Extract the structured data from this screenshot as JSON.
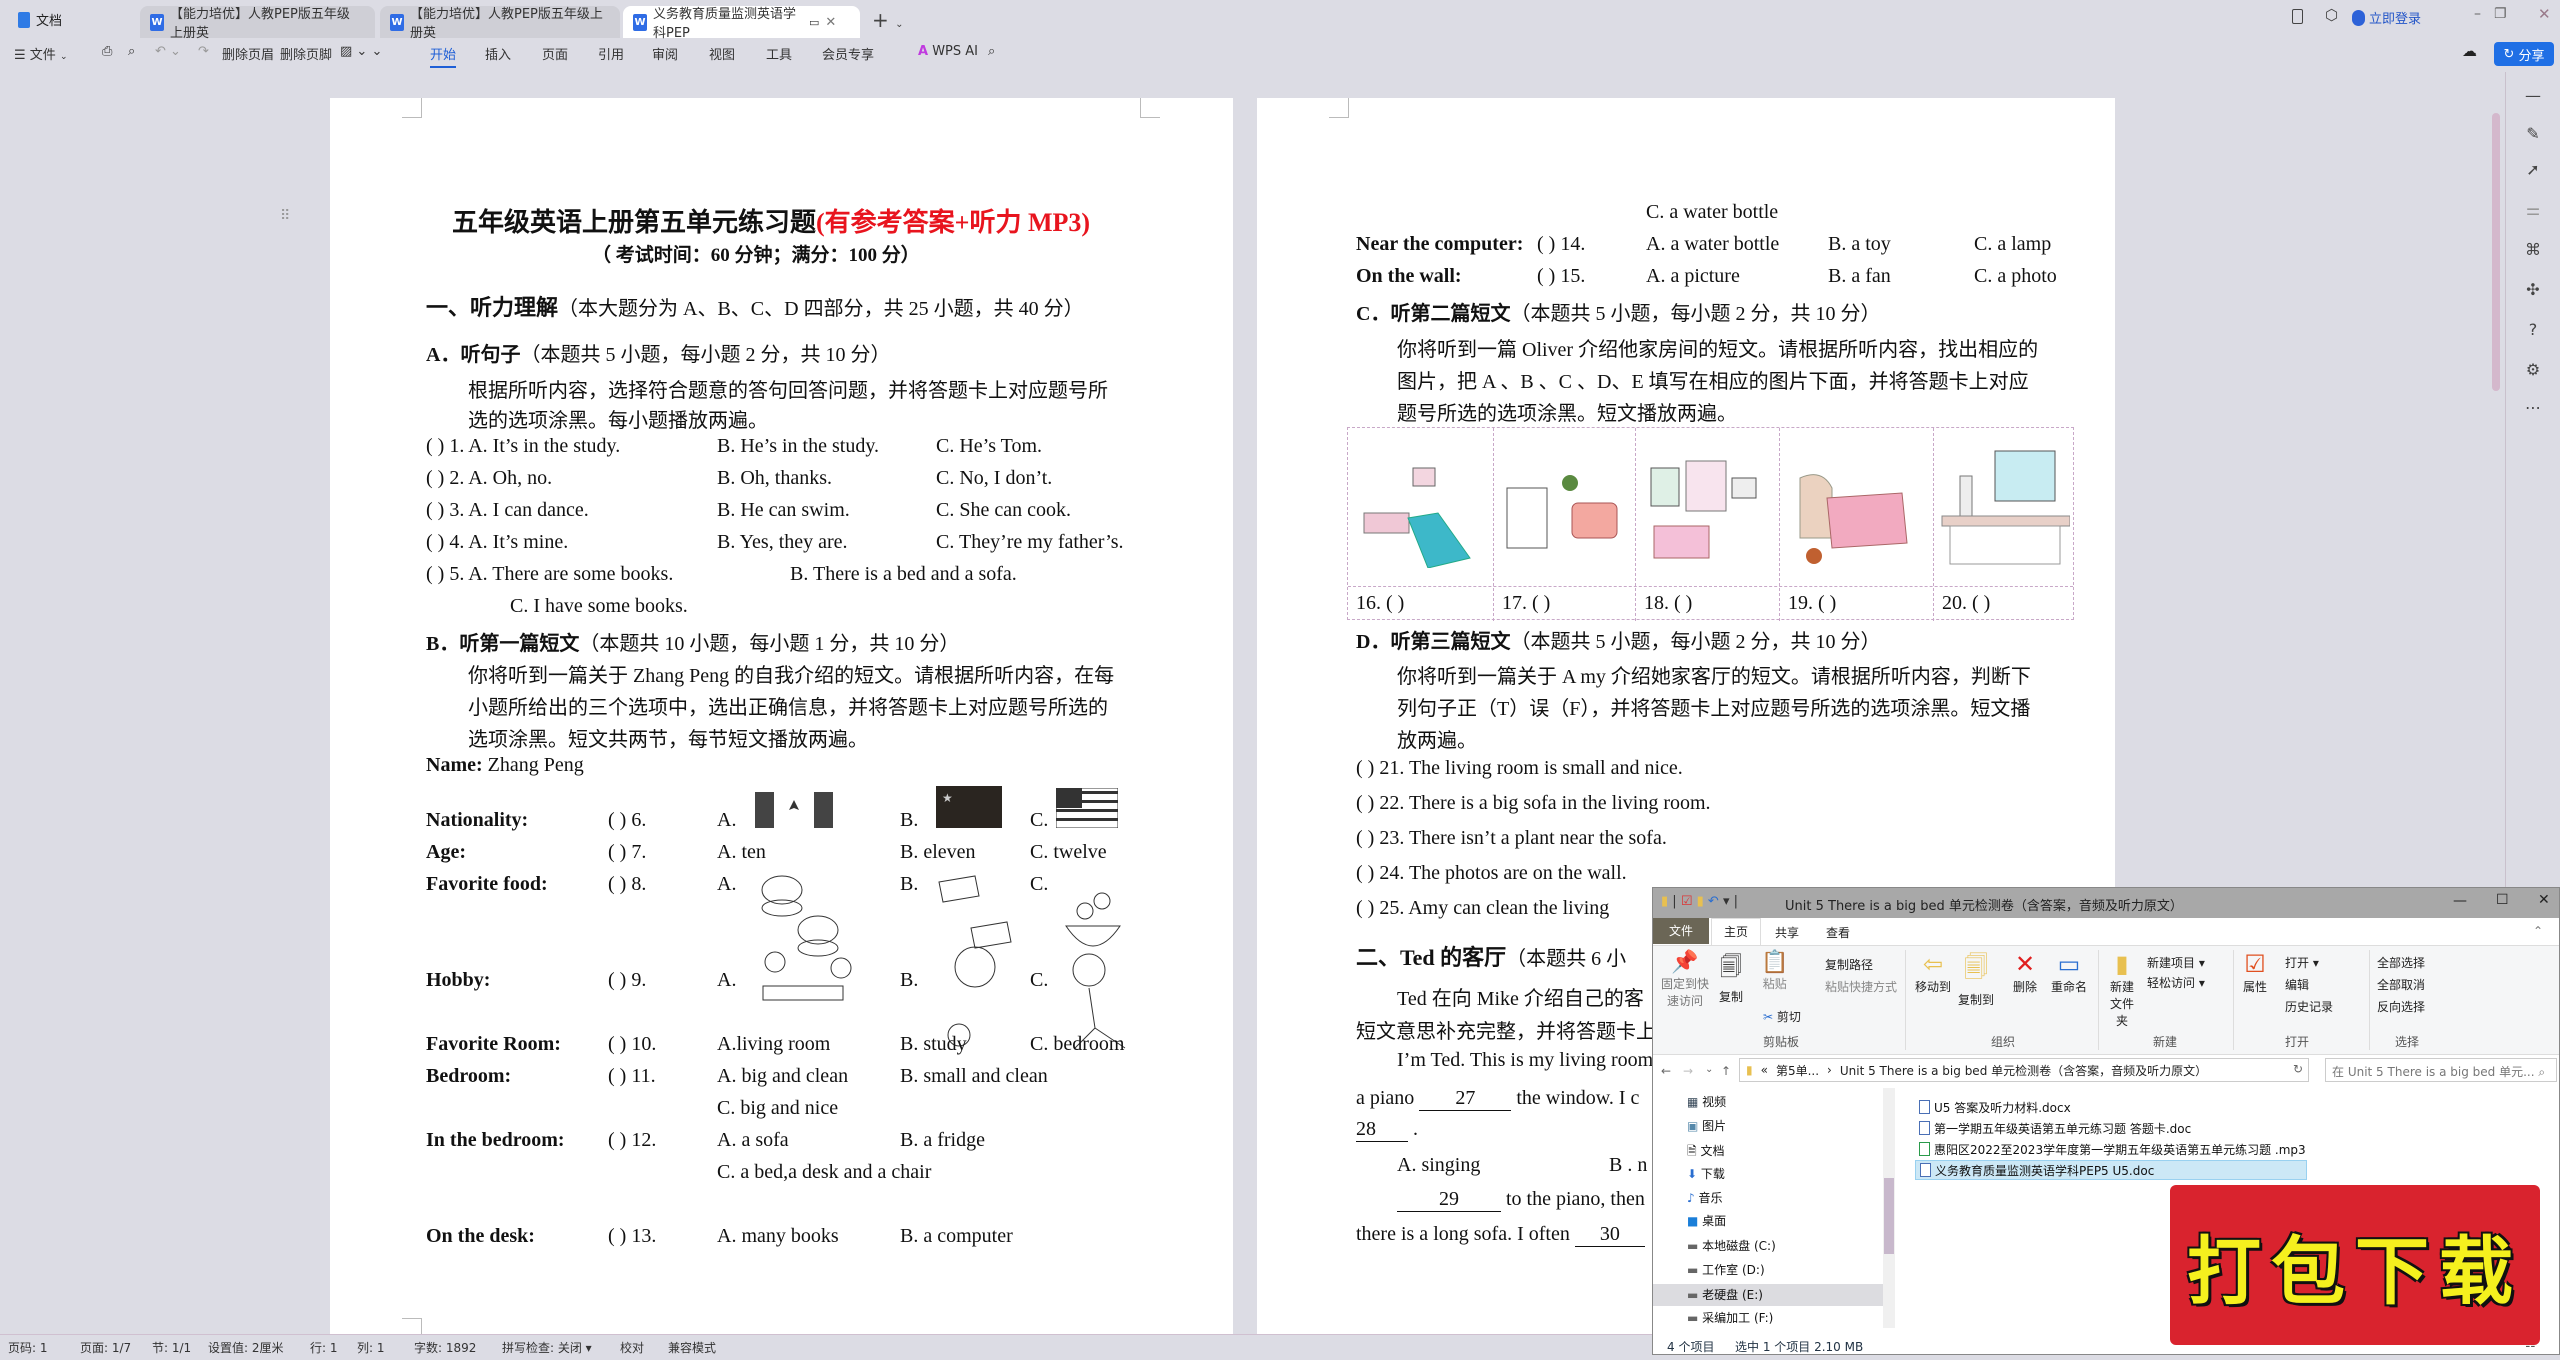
{
  "titlebar": {
    "home_tab": "文档",
    "tabs": [
      "【能力培优】人教PEP版五年级上册英",
      "【能力培优】人教PEP版五年级上册英",
      "义务教育质量监测英语学科PEP"
    ],
    "login": "立即登录"
  },
  "toolbar": {
    "file_menu": "文件",
    "delete_header": "删除页眉",
    "delete_footer": "删除页脚",
    "tabs": [
      "开始",
      "插入",
      "页面",
      "引用",
      "审阅",
      "视图",
      "工具",
      "会员专享"
    ],
    "active_tab": "开始",
    "wps_ai": "WPS AI",
    "share": "分享",
    "accent": "#1f6fe5"
  },
  "left_page": {
    "title": "五年级英语上册第五单元练习题",
    "title_highlight": "(有参考答案+听力 MP3)",
    "subtitle": "（ 考试时间：60 分钟；满分：100 分）",
    "sec1_heading": "一、听力理解",
    "sec1_note": "（本大题分为 A、B、C、D 四部分，共 25 小题，共 40 分）",
    "partA_heading": "A．听句子",
    "partA_note": "（本题共 5 小题，每小题 2 分，共 10 分）",
    "partA_instr": [
      "根据所听内容，选择符合题意的答句回答问题，并将答题卡上对应题号所",
      "选的选项涂黑。每小题播放两遍。"
    ],
    "partA_items": [
      {
        "q": "(      ) 1. A. It’s in the study.",
        "b": "B. He’s in the study.",
        "c": "C. He’s Tom."
      },
      {
        "q": "(      ) 2. A. Oh, no.",
        "b": "B. Oh, thanks.",
        "c": "C. No, I don’t."
      },
      {
        "q": "(      ) 3. A. I can dance.",
        "b": "B. He can swim.",
        "c": "C. She can cook."
      },
      {
        "q": "(      ) 4. A. It’s mine.",
        "b": "B. Yes, they are.",
        "c": "C. They’re my father’s."
      },
      {
        "q": "(      ) 5. A. There are some books.",
        "b": "B. There is a bed and a sofa.",
        "c": "C. I have some books."
      }
    ],
    "partB_heading": "B．听第一篇短文",
    "partB_note": "（本题共 10 小题，每小题 1 分，共 10 分）",
    "partB_instr": [
      "你将听到一篇关于 Zhang Peng 的自我介绍的短文。请根据所听内容，在每",
      "小题所给出的三个选项中，选出正确信息，并将答题卡上对应题号所选的",
      "选项涂黑。短文共两节，每节短文播放两遍。"
    ],
    "name_label": "Name:",
    "name_value": " Zhang Peng",
    "rows": [
      {
        "label": "Nationality:",
        "num": "(      ) 6.",
        "a": "A.",
        "b": "B.",
        "c": "C."
      },
      {
        "label": "Age:",
        "num": "(      ) 7.",
        "a": "A. ten",
        "b": "B. eleven",
        "c": "C. twelve"
      },
      {
        "label": "Favorite food:",
        "num": "(      ) 8.",
        "a": "A.",
        "b": "B.",
        "c": "C."
      },
      {
        "label": "Hobby:",
        "num": "(      ) 9.",
        "a": "A.",
        "b": "B.",
        "c": "C."
      },
      {
        "label": "Favorite Room:",
        "num": "(      ) 10.",
        "a": "A.living room",
        "b": "B. study",
        "c": "C. bedroom"
      },
      {
        "label": "Bedroom:",
        "num": "(      ) 11.",
        "a": "A. big and clean",
        "b": "B. small and clean",
        "c": "C. big and nice"
      },
      {
        "label": "In the bedroom:",
        "num": "(      ) 12.",
        "a": "A. a sofa",
        "b": "B. a fridge",
        "c": "C. a bed,a desk and a chair"
      },
      {
        "label": "On the desk:",
        "num": "(      ) 13.",
        "a": "A. many books",
        "b": "B. a computer"
      }
    ]
  },
  "right_page": {
    "q13_c": "C. a water bottle",
    "rows": [
      {
        "label": "Near the computer:",
        "num": "(      ) 14.",
        "a": "A. a water bottle",
        "b": "B. a toy",
        "c": "C. a lamp"
      },
      {
        "label": "On the wall:",
        "num": "(      ) 15.",
        "a": "A. a picture",
        "b": "B. a fan",
        "c": "C. a photo"
      }
    ],
    "partC_heading": "C．听第二篇短文",
    "partC_note": "（本题共 5 小题，每小题 2 分，共 10 分）",
    "partC_instr": [
      "你将听到一篇 Oliver  介绍他家房间的短文。请根据所听内容，找出相应的",
      "图片，把 A 、B 、C 、D、E 填写在相应的图片下面，并将答题卡上对应",
      "题号所选的选项涂黑。短文播放两遍。"
    ],
    "pictures": [
      "16. (         )",
      "17. (         )",
      "18. (         )",
      "19. (         )",
      "20. (         )"
    ],
    "partD_heading": "D．听第三篇短文",
    "partD_note": "（本题共 5 小题，每小题 2 分，共 10 分）",
    "partD_instr": [
      "你将听到一篇关于  A my  介绍她家客厅的短文。请根据所听内容，判断下",
      "列句子正（T）误（F），并将答题卡上对应题号所选的选项涂黑。短文播",
      "放两遍。"
    ],
    "partD_items": [
      "(      ) 21. The living room is small and nice.",
      "(      ) 22. There is a big sofa in the living room.",
      "(      ) 23. There isn’t a plant near the sofa.",
      "(      ) 24. The photos are on the wall.",
      "(      ) 25. Amy can clean the living"
    ],
    "sec2_heading": "二、Ted 的客厅",
    "sec2_note": "（本题共 6 小",
    "sec2_lines": [
      "Ted 在向  Mike  介绍自己的客",
      "短文意思补充完整，并将答题卡上",
      "I’m Ted. This is my living room"
    ],
    "cloze": {
      "l4a": "a piano ",
      "b27": "27",
      "l4b": " the window. I c",
      "b28": "28",
      "l5": " .",
      "optA": "A.  singing",
      "optB": "B . n",
      "b29": "29",
      "l7": " to the piano, then",
      "l8": "there is a long sofa. I often ",
      "b30": "30"
    }
  },
  "statusbar": {
    "items": [
      "页码: 1",
      "页面: 1/7",
      "节: 1/1",
      "设置值: 2厘米",
      "行: 1",
      "列: 1",
      "字数: 1892",
      "拼写检查: 关闭 ▾",
      "校对",
      "兼容模式"
    ]
  },
  "explorer": {
    "title": "Unit 5 There is a big bed 单元检测卷（含答案，音频及听力原文）",
    "ribbon_tabs": [
      "文件",
      "主页",
      "共享",
      "查看"
    ],
    "clipboard": {
      "pin": "固定到快速访问",
      "copy": "复制",
      "paste": "粘贴",
      "copy_path": "复制路径",
      "paste_shortcut": "粘贴快捷方式",
      "cut": "剪切",
      "group": "剪贴板"
    },
    "organize": {
      "move": "移动到",
      "copy_to": "复制到",
      "delete": "删除",
      "rename": "重命名",
      "group": "组织"
    },
    "new": {
      "folder": "新建文件夹",
      "item": "新建项目 ▾",
      "easy": "轻松访问 ▾",
      "group": "新建"
    },
    "open": {
      "props": "属性",
      "open": "打开 ▾",
      "edit": "编辑",
      "history": "历史记录",
      "group": "打开"
    },
    "select": {
      "all": "全部选择",
      "none": "全部取消",
      "invert": "反向选择",
      "group": "选择"
    },
    "address": [
      "第5单...",
      "Unit 5 There is a big bed 单元检测卷（含答案，音频及听力原文）"
    ],
    "search_placeholder": "在 Unit 5 There is a big bed 单元...",
    "nav": [
      "视频",
      "图片",
      "文档",
      "下载",
      "音乐",
      "桌面",
      "本地磁盘 (C:)",
      "工作室 (D:)",
      "老硬盘 (E:)",
      "采编加工 (F:)"
    ],
    "files": [
      "U5 答案及听力材料.docx",
      "第一学期五年级英语第五单元练习题  答题卡.doc",
      "惠阳区2022至2023学年度第一学期五年级英语第五单元练习题 .mp3",
      "义务教育质量监测英语学科PEP5 U5.doc"
    ],
    "selected_file": "义务教育质量监测英语学科PEP5 U5.doc",
    "status_count": "4 个项目",
    "status_selected": "选中 1 个项目  2.10 MB"
  },
  "stamp": {
    "text": "打包下载",
    "bg": "#d9232e",
    "fg": "#f5f01e"
  }
}
